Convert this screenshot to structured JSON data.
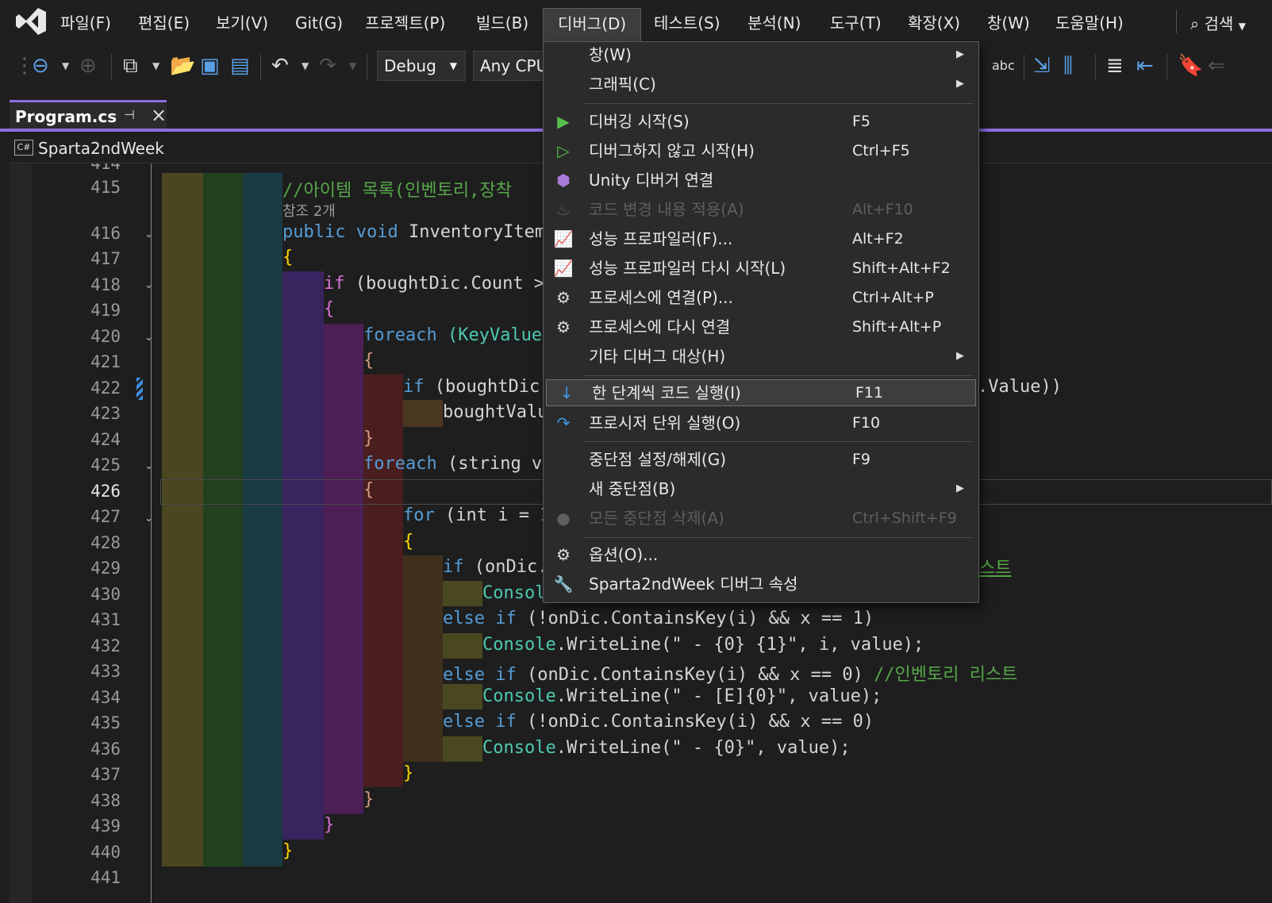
{
  "menubar": {
    "items": [
      "파일(F)",
      "편집(E)",
      "보기(V)",
      "Git(G)",
      "프로젝트(P)",
      "빌드(B)",
      "디버그(D)",
      "테스트(S)",
      "분석(N)",
      "도구(T)",
      "확장(X)",
      "창(W)",
      "도움말(H)"
    ],
    "active": "디버그(D)",
    "search_label": "검색"
  },
  "toolbar": {
    "config": "Debug",
    "platform": "Any CPU"
  },
  "tab": {
    "title": "Program.cs"
  },
  "navbar": {
    "project_badge": "C#",
    "project": "Sparta2ndWeek"
  },
  "editor": {
    "line_numbers": [
      "414",
      "415",
      "416",
      "417",
      "418",
      "419",
      "420",
      "421",
      "422",
      "423",
      "424",
      "425",
      "426",
      "427",
      "428",
      "429",
      "430",
      "431",
      "432",
      "433",
      "434",
      "435",
      "436",
      "437",
      "438",
      "439",
      "440",
      "441"
    ],
    "current_line": "426",
    "codelens": "참조 2개",
    "lines": {
      "l415": "//아이템 목록(인벤토리,장착",
      "l416a": "public void ",
      "l416b": "InventoryItemL",
      "l417": "{",
      "l418a": "if ",
      "l418b": "(boughtDic.Count >",
      "l419": "{",
      "l420a": "foreach ",
      "l420b": "(KeyValueP",
      "l421": "{",
      "l422a": "if ",
      "l422b": "(boughtDic.",
      "l422tail": ".Value))",
      "l423": "boughtValu",
      "l424": "}",
      "l425a": "foreach ",
      "l425b": "(string va",
      "l426": "{",
      "l427a": "for ",
      "l427b": "(int i = 1",
      "l428": "{",
      "l429a": "if ",
      "l429b": "(onDic.",
      "l429tail": "스트",
      "l430": "Consol",
      "l431a": "else if ",
      "l431b": "(!onDic.ContainsKey(i) && x == 1)",
      "l432a": "Console",
      "l432b": ".WriteLine(\" - {0} {1}\", i, value);",
      "l433a": "else if ",
      "l433b": "(onDic.ContainsKey(i) && x == 0) ",
      "l433c": "//인벤토리 리스트",
      "l434a": "Console",
      "l434b": ".WriteLine(\" - [E]{0}\", value);",
      "l435a": "else if ",
      "l435b": "(!onDic.ContainsKey(i) && x == 0)",
      "l436a": "Console",
      "l436b": ".WriteLine(\" - {0}\", value);",
      "l437": "}",
      "l438": "}",
      "l439": "}",
      "l440": "}"
    }
  },
  "debug_menu": {
    "items": [
      {
        "label": "창(W)",
        "shortcut": "",
        "icon": "none"
      },
      {
        "label": "그래픽(C)",
        "shortcut": "",
        "icon": "none"
      },
      {
        "label": "디버깅 시작(S)",
        "shortcut": "F5",
        "icon": "play-filled-icon"
      },
      {
        "label": "디버그하지 않고 시작(H)",
        "shortcut": "Ctrl+F5",
        "icon": "play-outline-icon"
      },
      {
        "label": "Unity 디버거 연결",
        "shortcut": "",
        "icon": "unity-cube-icon"
      },
      {
        "label": "코드 변경 내용 적용(A)",
        "shortcut": "Alt+F10",
        "icon": "flame-icon"
      },
      {
        "label": "성능 프로파일러(F)...",
        "shortcut": "Alt+F2",
        "icon": "profiler-chart-icon"
      },
      {
        "label": "성능 프로파일러 다시 시작(L)",
        "shortcut": "Shift+Alt+F2",
        "icon": "profiler-chart-icon"
      },
      {
        "label": "프로세스에 연결(P)...",
        "shortcut": "Ctrl+Alt+P",
        "icon": "gears-icon"
      },
      {
        "label": "프로세스에 다시 연결",
        "shortcut": "Shift+Alt+P",
        "icon": "gears-icon"
      },
      {
        "label": "기타 디버그 대상(H)",
        "shortcut": "",
        "icon": "none"
      },
      {
        "label": "한 단계씩 코드 실행(I)",
        "shortcut": "F11",
        "icon": "step-into-icon"
      },
      {
        "label": "프로시저 단위 실행(O)",
        "shortcut": "F10",
        "icon": "step-over-icon"
      },
      {
        "label": "중단점 설정/해제(G)",
        "shortcut": "F9",
        "icon": "none"
      },
      {
        "label": "새 중단점(B)",
        "shortcut": "",
        "icon": "none"
      },
      {
        "label": "모든 중단점 삭제(A)",
        "shortcut": "Ctrl+Shift+F9",
        "icon": "delete-breakpoints-icon"
      },
      {
        "label": "옵션(O)...",
        "shortcut": "",
        "icon": "gear-icon"
      },
      {
        "label": "Sparta2ndWeek 디버그 속성",
        "shortcut": "",
        "icon": "wrench-icon"
      }
    ],
    "selected": "한 단계씩 코드 실행(I)"
  },
  "colors": {
    "accent": "#8c6ee0",
    "menu_bg": "#2b2b2b",
    "play_green": "#57c04c",
    "unity_purple": "#a77bd8",
    "step_blue": "#3d9be9"
  }
}
